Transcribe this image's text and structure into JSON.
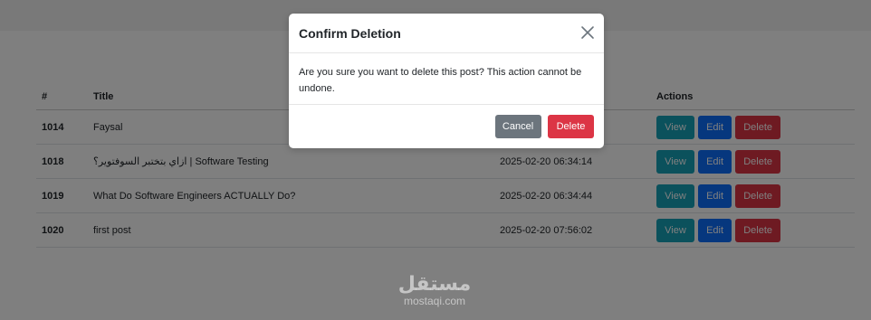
{
  "table": {
    "headers": [
      "#",
      "Title",
      "",
      "Actions"
    ],
    "rows": [
      {
        "id": "1014",
        "title": "Faysal",
        "date": ""
      },
      {
        "id": "1018",
        "title": "ازاي بتختبر السوفتوير؟ | Software Testing",
        "date": "2025-02-20 06:34:14"
      },
      {
        "id": "1019",
        "title": "What Do Software Engineers ACTUALLY Do?",
        "date": "2025-02-20 06:34:44"
      },
      {
        "id": "1020",
        "title": "first post",
        "date": "2025-02-20 07:56:02"
      }
    ],
    "actions": {
      "view": "View",
      "edit": "Edit",
      "delete": "Delete"
    }
  },
  "modal": {
    "title": "Confirm Deletion",
    "message": "Are you sure you want to delete this post? This action cannot be undone.",
    "cancel_label": "Cancel",
    "delete_label": "Delete"
  },
  "watermark": {
    "logo": "مستقل",
    "domain": "mostaqi.com"
  },
  "colors": {
    "view": "#17a2b8",
    "edit": "#0d6efd",
    "delete": "#dc3545",
    "cancel": "#6c757d"
  },
  "icons": {
    "close": "close-icon"
  }
}
